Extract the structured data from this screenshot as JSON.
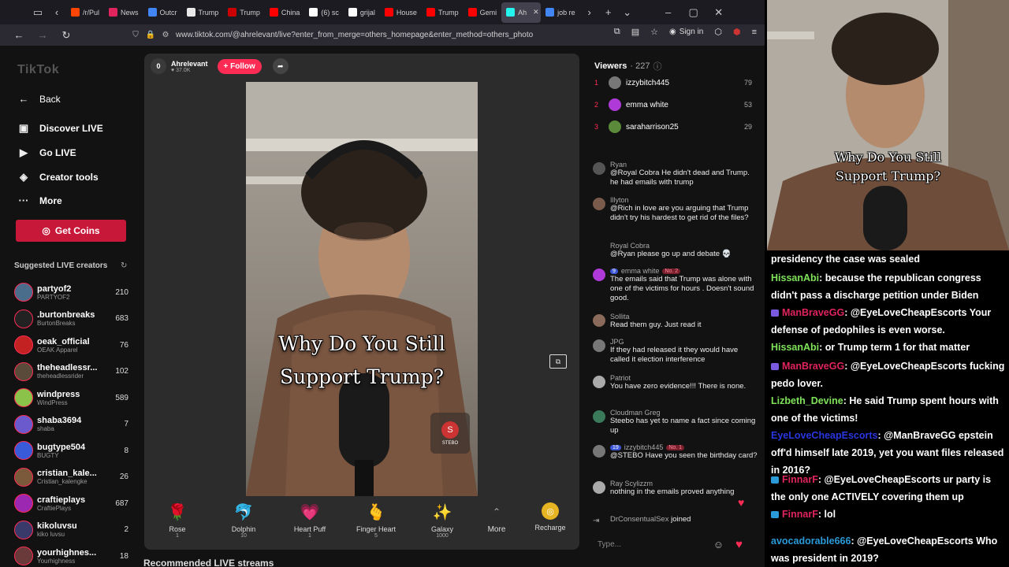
{
  "browser": {
    "tabs": [
      {
        "label": "/r/Pul",
        "color": "#ff4500"
      },
      {
        "label": "News",
        "color": "#e0245e"
      },
      {
        "label": "Outcr",
        "color": "#4285f4"
      },
      {
        "label": "Trump",
        "color": "#e8e8e8"
      },
      {
        "label": "Trump",
        "color": "#cc0000"
      },
      {
        "label": "China",
        "color": "#ff0000"
      },
      {
        "label": "(6) sc",
        "color": "#ffffff"
      },
      {
        "label": "grijal",
        "color": "#ffffff"
      },
      {
        "label": "House",
        "color": "#ff0000"
      },
      {
        "label": "Trump",
        "color": "#ff0000"
      },
      {
        "label": "Gemi",
        "color": "#ff0000"
      },
      {
        "label": "Ah",
        "color": "#25f4ee"
      },
      {
        "label": "job re",
        "color": "#4285f4"
      }
    ],
    "url": "www.tiktok.com/@ahrelevant/live?enter_from_merge=others_homepage&enter_method=others_photo",
    "signin": "Sign in"
  },
  "sidebar": {
    "logo": "TikTok",
    "back": "Back",
    "discover": "Discover LIVE",
    "golive": "Go LIVE",
    "creator_tools": "Creator tools",
    "more": "More",
    "coins": "Get Coins",
    "suggested_title": "Suggested LIVE creators",
    "creators": [
      {
        "name": "partyof2",
        "sub": "PARTYOF2",
        "count": "210",
        "color": "#4a6d8c"
      },
      {
        "name": ".burtonbreaks",
        "sub": "BurtonBreaks",
        "count": "683",
        "color": "#222222"
      },
      {
        "name": "oeak_official",
        "sub": "OEAK Apparel",
        "count": "76",
        "color": "#c22222"
      },
      {
        "name": "theheadlessr...",
        "sub": "theheadlessrider",
        "count": "102",
        "color": "#5a4a3a"
      },
      {
        "name": "windpress",
        "sub": "WindPress",
        "count": "589",
        "color": "#8bc34a"
      },
      {
        "name": "shaba3694",
        "sub": "shaba",
        "count": "7",
        "color": "#6a5acd"
      },
      {
        "name": "bugtype504",
        "sub": "BUGTY",
        "count": "8",
        "color": "#3a5bd9"
      },
      {
        "name": "cristian_kale...",
        "sub": "Cristian_kalengke",
        "count": "26",
        "color": "#7a5a3a"
      },
      {
        "name": "craftieplays",
        "sub": "CraftiePlays",
        "count": "687",
        "color": "#9c27b0"
      },
      {
        "name": "kikoluvsu",
        "sub": "kiko luvsu",
        "count": "2",
        "color": "#3a3a6a"
      },
      {
        "name": "yourhighnes...",
        "sub": "Yourhighness",
        "count": "18",
        "color": "#6a3a3a"
      }
    ]
  },
  "live": {
    "host_badge": "0",
    "host_name": "Ahrelevant",
    "host_likes": "37.0K",
    "follow": "+ Follow",
    "caption_line1": "Why Do You Still",
    "caption_line2": "Support Trump?",
    "gift_initial": "S",
    "gift_label": "STEBO",
    "gifts": [
      {
        "name": "Rose",
        "price": "1",
        "icon": "🌹"
      },
      {
        "name": "Dolphin",
        "price": "10",
        "icon": "🐬"
      },
      {
        "name": "Heart Puff",
        "price": "1",
        "icon": "💗"
      },
      {
        "name": "Finger Heart",
        "price": "5",
        "icon": "🫰"
      },
      {
        "name": "Galaxy",
        "price": "1000",
        "icon": "✨"
      }
    ],
    "more": "More",
    "recharge": "Recharge"
  },
  "recommended": "Recommended LIVE streams",
  "chat": {
    "viewers_label": "Viewers",
    "viewers_count": "· 227",
    "top_viewers": [
      {
        "rank": "1",
        "name": "izzybitch445",
        "score": "79",
        "color": "#777777"
      },
      {
        "rank": "2",
        "name": "emma white",
        "score": "53",
        "color": "#b03ad8"
      },
      {
        "rank": "3",
        "name": "saraharrison25",
        "score": "29",
        "color": "#5a8a3a"
      }
    ],
    "comments": [
      {
        "user": "Ryan",
        "msg": "@Royal Cobra He didn't dead and Trump. he had emails with trump",
        "color": "#555555"
      },
      {
        "user": "Illyton",
        "msg": "@Rich in love are you arguing that Trump didn't try his hardest to get rid of the files?",
        "color": "#7a5a4a"
      },
      {
        "user": "Royal Cobra",
        "msg": "@Ryan please go up and debate 💀",
        "color": "#121212"
      },
      {
        "user": "emma white",
        "lv": "9",
        "no": "No. 2",
        "msg": "The emails said that Trump was alone with one of the victims for hours . Doesn't sound good.",
        "color": "#b03ad8"
      },
      {
        "user": "Sollita",
        "msg": "Read them guy. Just read it",
        "color": "#8a6a5a"
      },
      {
        "user": "JPG",
        "msg": "If they had released it they would have called it election interference",
        "color": "#777777"
      },
      {
        "user": "Patriot",
        "msg": "You have zero evidence!!! There is none.",
        "color": "#aaaaaa"
      },
      {
        "user": "Cloudman Greg",
        "msg": "Steebo has yet to name a fact since coming up",
        "color": "#3a7a5a"
      },
      {
        "user": "izzybitch445",
        "lv": "19",
        "no": "No. 1",
        "msg": "@STEBO Have you seen the birthday card?",
        "color": "#777777"
      },
      {
        "user": "Ray Scylizzm",
        "msg": "nothing in the emails proved anything",
        "color": "#aaaaaa"
      }
    ],
    "joined_user": "DrConsentualSex",
    "joined_text": "joined",
    "type_placeholder": "Type..."
  },
  "overlay": {
    "caption_line1": "Why Do You Still",
    "caption_line2": "Support Trump?",
    "messages": [
      {
        "user": "",
        "text": "presidency the case was sealed",
        "ucolor": "#ffffff"
      },
      {
        "user": "HissanAbi",
        "text": ": because the republican congress didn't pass a discharge petition under Biden",
        "ucolor": "#7fe35a"
      },
      {
        "user": "ManBraveGG",
        "text": ": @EyeLoveCheapEscorts Your defense of pedophiles is even worse.",
        "ucolor": "#e0245e",
        "badge": "#7a5ae0"
      },
      {
        "user": "HissanAbi",
        "text": ": or Trump term 1 for that matter",
        "ucolor": "#7fe35a"
      },
      {
        "user": "ManBraveGG",
        "text": ": @EyeLoveCheapEscorts fucking pedo lover.",
        "ucolor": "#e0245e",
        "badge": "#7a5ae0"
      },
      {
        "user": "Lizbeth_Devine",
        "text": ": He said Trump spent hours with one of the victims!",
        "ucolor": "#7fe35a"
      },
      {
        "user": "EyeLoveCheapEscorts",
        "text": ": @ManBraveGG epstein off'd himself late 2019, yet you want files released in 2016?",
        "ucolor": "#2a36e0"
      },
      {
        "user": "FinnarF",
        "text": ": @EyeLoveCheapEscorts ur party is the only one ACTIVELY covering them up",
        "ucolor": "#e0245e",
        "badge": "#2a9ad8"
      },
      {
        "user": "FinnarF",
        "text": ": lol",
        "ucolor": "#e0245e",
        "badge": "#2a9ad8"
      },
      {
        "user": "avocadorable666",
        "text": ": @EyeLoveCheapEscorts Who was president in 2019?",
        "ucolor": "#2a9ad8"
      }
    ]
  }
}
